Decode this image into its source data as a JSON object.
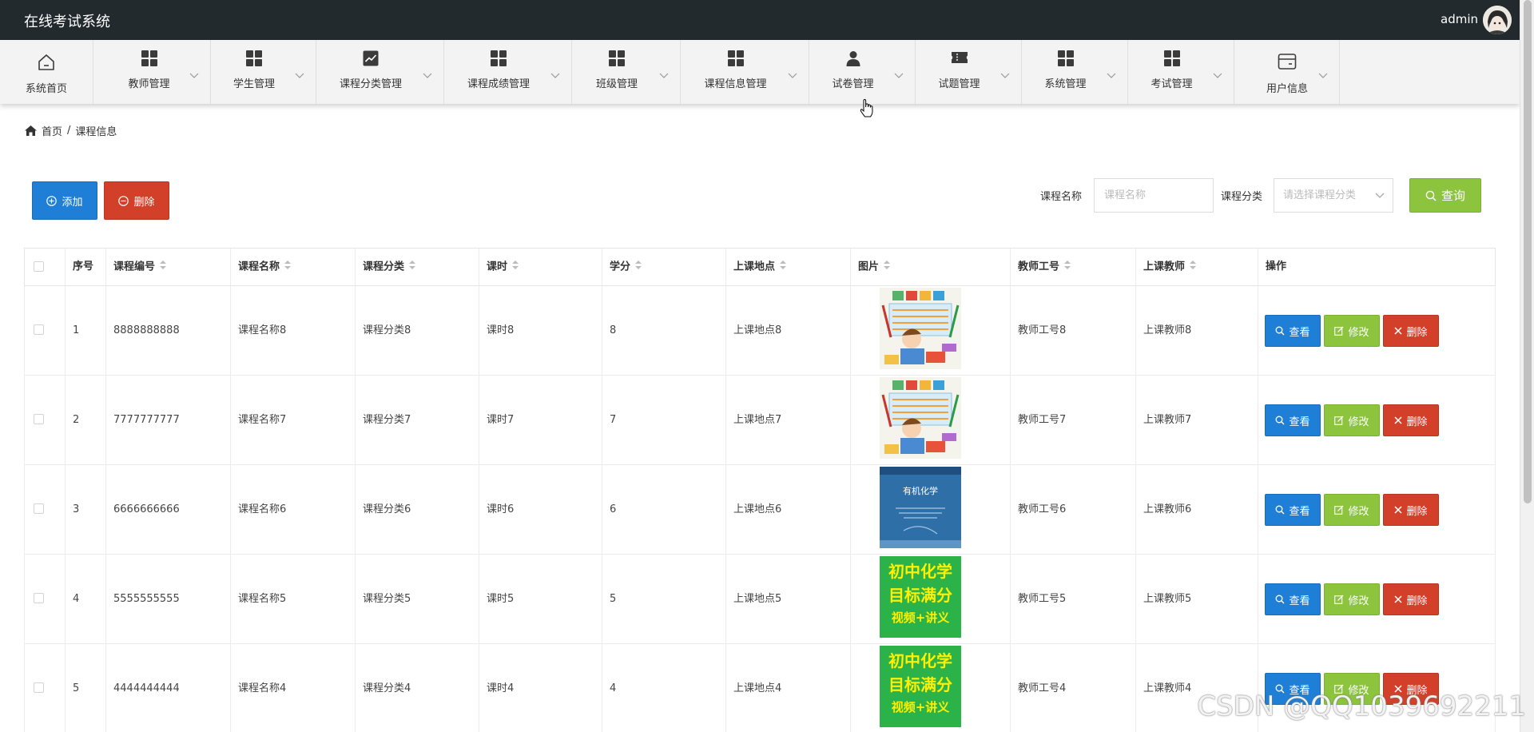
{
  "header": {
    "title": "在线考试系统",
    "user": "admin"
  },
  "nav": [
    {
      "label": "系统首页",
      "icon": "home-icon"
    },
    {
      "label": "教师管理",
      "icon": "grid-icon"
    },
    {
      "label": "学生管理",
      "icon": "grid-icon"
    },
    {
      "label": "课程分类管理",
      "icon": "chart-icon"
    },
    {
      "label": "课程成绩管理",
      "icon": "grid-icon"
    },
    {
      "label": "班级管理",
      "icon": "grid-icon"
    },
    {
      "label": "课程信息管理",
      "icon": "grid-icon"
    },
    {
      "label": "试卷管理",
      "icon": "user-icon"
    },
    {
      "label": "试题管理",
      "icon": "ticket-icon"
    },
    {
      "label": "系统管理",
      "icon": "grid-icon"
    },
    {
      "label": "考试管理",
      "icon": "grid-icon"
    },
    {
      "label": "用户信息",
      "icon": "wallet-icon"
    }
  ],
  "breadcrumb": {
    "home": "首页",
    "separator": "/",
    "current": "课程信息"
  },
  "toolbar": {
    "add_label": "添加",
    "delete_label": "删除",
    "name_label": "课程名称",
    "name_placeholder": "课程名称",
    "category_label": "课程分类",
    "category_placeholder": "请选择课程分类",
    "query_label": "查询"
  },
  "table": {
    "columns": [
      "序号",
      "课程编号",
      "课程名称",
      "课程分类",
      "课时",
      "学分",
      "上课地点",
      "图片",
      "教师工号",
      "上课教师",
      "操作"
    ],
    "actions": {
      "view": "查看",
      "edit": "修改",
      "delete": "删除"
    },
    "rows": [
      {
        "index": "1",
        "code": "8888888888",
        "name": "课程名称8",
        "category": "课程分类8",
        "hours": "课时8",
        "credit": "8",
        "location": "上课地点8",
        "image": "cartoon",
        "teacher_id": "教师工号8",
        "teacher": "上课教师8"
      },
      {
        "index": "2",
        "code": "7777777777",
        "name": "课程名称7",
        "category": "课程分类7",
        "hours": "课时7",
        "credit": "7",
        "location": "上课地点7",
        "image": "cartoon",
        "teacher_id": "教师工号7",
        "teacher": "上课教师7"
      },
      {
        "index": "3",
        "code": "6666666666",
        "name": "课程名称6",
        "category": "课程分类6",
        "hours": "课时6",
        "credit": "6",
        "location": "上课地点6",
        "image": "book",
        "teacher_id": "教师工号6",
        "teacher": "上课教师6"
      },
      {
        "index": "4",
        "code": "5555555555",
        "name": "课程名称5",
        "category": "课程分类5",
        "hours": "课时5",
        "credit": "5",
        "location": "上课地点5",
        "image": "green",
        "teacher_id": "教师工号5",
        "teacher": "上课教师5"
      },
      {
        "index": "5",
        "code": "4444444444",
        "name": "课程名称4",
        "category": "课程分类4",
        "hours": "课时4",
        "credit": "4",
        "location": "上课地点4",
        "image": "green",
        "teacher_id": "教师工号4",
        "teacher": "上课教师4"
      }
    ]
  },
  "thumbnails": {
    "book": {
      "title": "有机化学"
    },
    "green": {
      "line1": "初中化学",
      "line2": "目标满分",
      "line3": "视频+讲义"
    }
  },
  "watermark": "CSDN @QQ1039692211",
  "colors": {
    "header_bg": "#232a2e",
    "primary": "#1f7fd6",
    "success": "#8cc43e",
    "danger": "#d2402a"
  }
}
